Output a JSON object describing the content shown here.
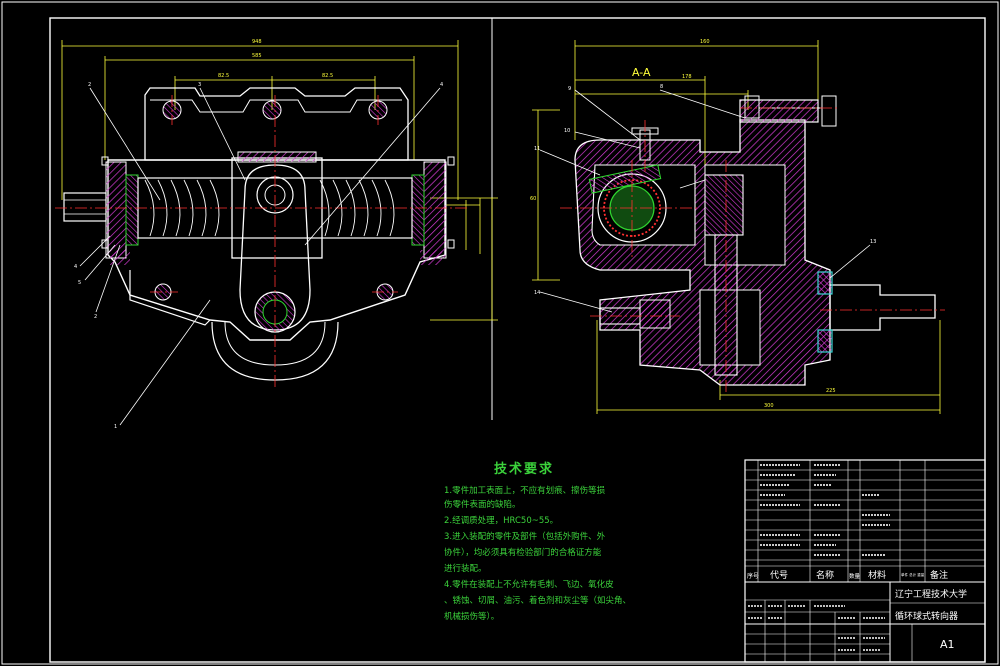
{
  "section_label": "A-A",
  "tech_requirements": {
    "title": "技术要求",
    "lines": [
      "1.零件加工表面上，不应有划痕、擦伤等损",
      "伤零件表面的缺陷。",
      "2.经调质处理，HRC50~55。",
      "3.进入装配的零件及部件（包括外购件、外",
      "协件），均必须具有检验部门的合格证方能",
      "进行装配。",
      "4.零件在装配上不允许有毛刺、飞边、氧化皮",
      "、锈蚀、切屑、油污、着色剂和灰尘等（如尖角、",
      "机械损伤等）。"
    ]
  },
  "title_block": {
    "header": {
      "seq": "序号",
      "code": "代号",
      "name": "名称",
      "qty": "数量",
      "material": "材料",
      "weight": "单件 总计 重量",
      "remark": "备注"
    },
    "university": "辽宁工程技术大学",
    "drawing_name": "循环球式转向器",
    "sheet_size": "A1"
  },
  "colors": {
    "outline": "#ffffff",
    "green": "#2fd62f",
    "hatch": "#d63cd6",
    "center": "#ff3030",
    "dim": "#ffff3a",
    "cyan": "#3ad6d6",
    "frame": "#ffffff"
  }
}
